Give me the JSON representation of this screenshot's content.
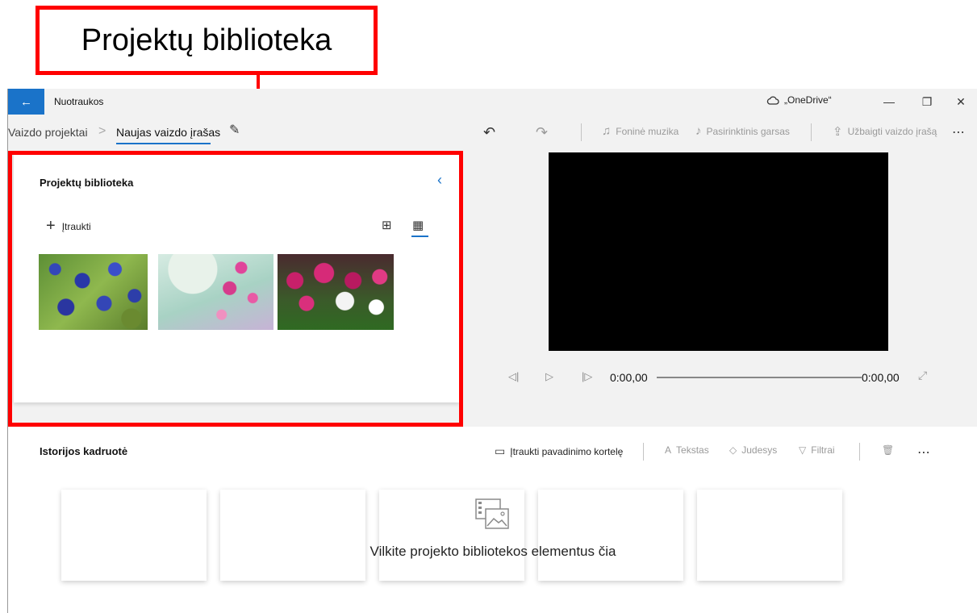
{
  "callout": {
    "label": "Projektų biblioteka"
  },
  "window": {
    "app_title": "Nuotraukos",
    "onedrive_label": "„OneDrive“",
    "back_icon": "←",
    "minimize_icon": "—",
    "restore_icon": "❐",
    "close_icon": "✕"
  },
  "breadcrumb": {
    "parent": "Vaizdo projektai",
    "separator": ">",
    "current": "Naujas vaizdo įrašas",
    "edit_icon": "✎"
  },
  "toolbar": {
    "undo_icon": "↶",
    "redo_icon": "↷",
    "music_icon": "♫",
    "music_label": "Foninė muzika",
    "audio_icon": "♪",
    "audio_label": "Pasirinktinis garsas",
    "finish_icon": "⇪",
    "finish_label": "Užbaigti vaizdo įrašą",
    "more_icon": "⋯"
  },
  "library": {
    "title": "Projektų biblioteka",
    "collapse_icon": "‹",
    "add_icon": "+",
    "add_label": "Įtraukti",
    "view_large_icon": "⊞",
    "view_small_icon": "▦",
    "thumbnails": [
      "bluebonnet-flowers",
      "pink-blossoms",
      "pink-white-daisies"
    ]
  },
  "player": {
    "prev_icon": "◁|",
    "play_icon": "▷",
    "next_icon": "|▷",
    "time_current": "0:00,00",
    "time_total": "0:00,00",
    "fullscreen_icon": "⤢"
  },
  "storyboard": {
    "title": "Istorijos kadruotė",
    "title_card_icon": "▭",
    "title_card_label": "Įtraukti pavadinimo kortelę",
    "text_icon": "A",
    "text_label": "Tekstas",
    "motion_icon": "◇",
    "motion_label": "Judesys",
    "filters_icon": "▽",
    "filters_label": "Filtrai",
    "delete_icon": "🗑",
    "more_icon": "⋯",
    "drop_hint": "Vilkite projekto bibliotekos elementus čia"
  }
}
